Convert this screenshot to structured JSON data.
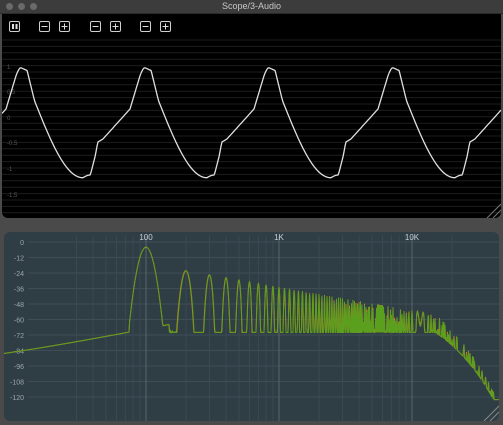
{
  "window": {
    "title": "Scope/3-Audio"
  },
  "toolbar": {
    "buttons": [
      {
        "name": "pause-button",
        "icon": "pause-icon"
      },
      {
        "name": "zoom-out-button-1",
        "icon": "minus-icon"
      },
      {
        "name": "zoom-in-button-1",
        "icon": "plus-icon"
      },
      {
        "name": "zoom-out-button-2",
        "icon": "minus-icon"
      },
      {
        "name": "zoom-in-button-2",
        "icon": "plus-icon"
      },
      {
        "name": "zoom-out-button-3",
        "icon": "minus-icon"
      },
      {
        "name": "zoom-in-button-3",
        "icon": "plus-icon"
      }
    ]
  },
  "scope": {
    "y_labels": [
      "1",
      "0.5",
      "0",
      "-0.5",
      "-1",
      "-1.5"
    ],
    "waveform_color": "#e0e0e0"
  },
  "spectrum": {
    "x_labels": [
      "100",
      "1K",
      "10K"
    ],
    "y_labels": [
      "0",
      "-12",
      "-24",
      "-36",
      "-48",
      "-60",
      "-72",
      "-84",
      "-96",
      "-108",
      "-120"
    ],
    "colors": {
      "series_1": "#e07820",
      "series_2": "#5aa01e",
      "background": "#2f3d45"
    }
  }
}
